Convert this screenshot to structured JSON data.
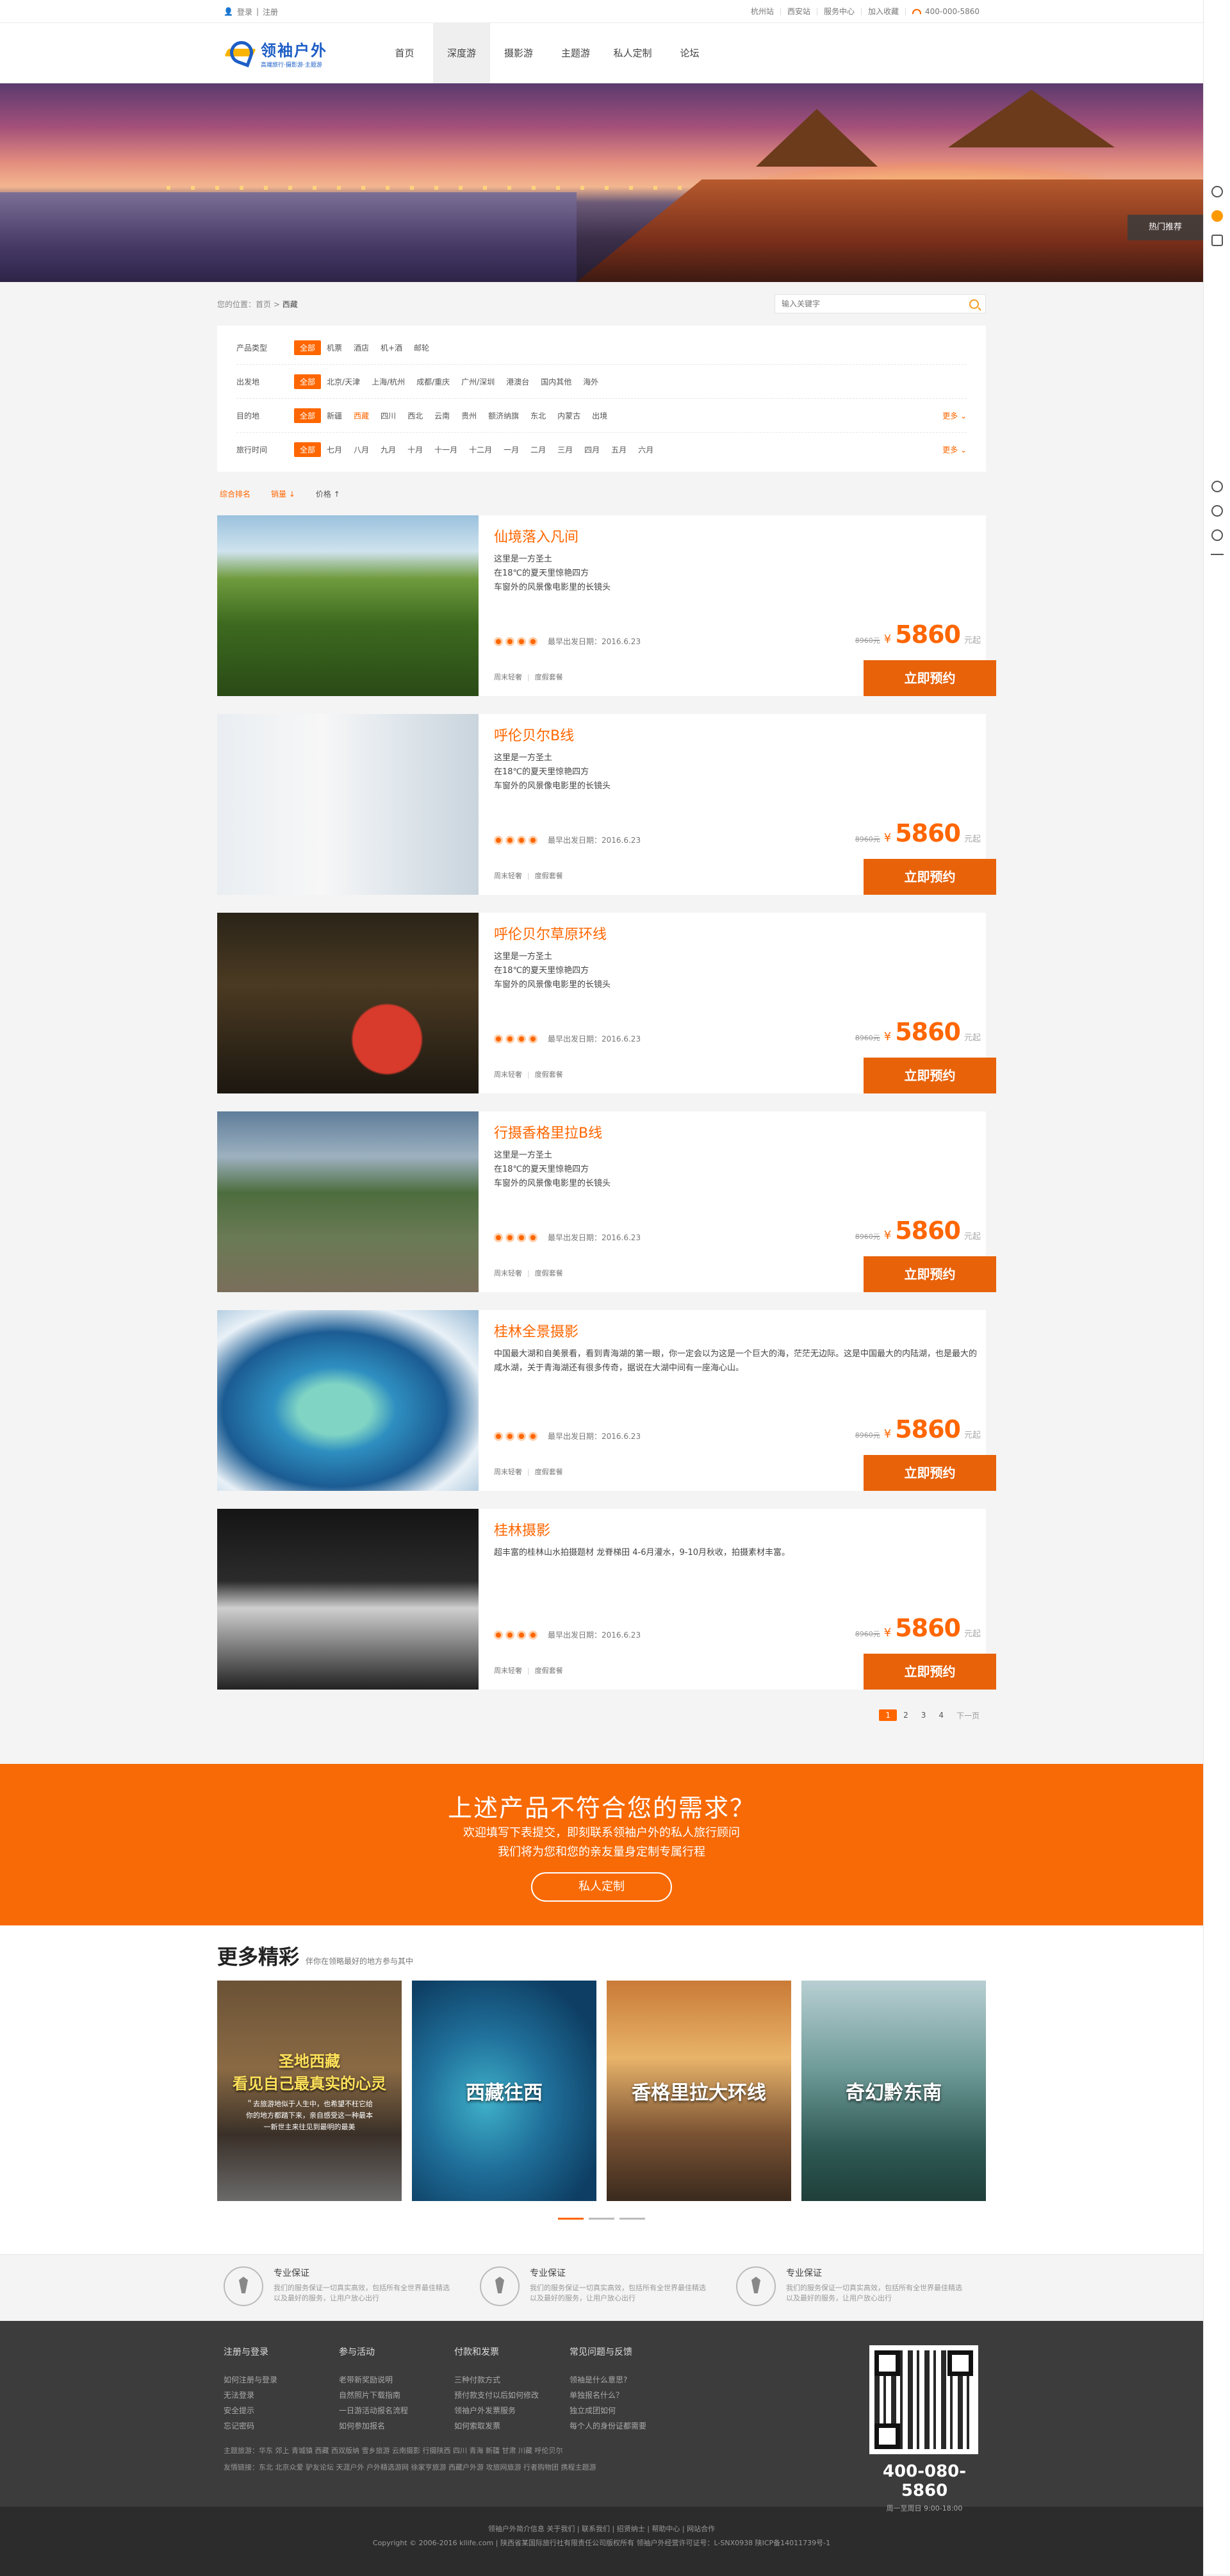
{
  "topbar": {
    "login": "登录",
    "register": "注册",
    "links": [
      "杭州站",
      "西安站",
      "服务中心",
      "加入收藏"
    ],
    "phone": "400-000-5860"
  },
  "header": {
    "logo_title": "领袖户外",
    "logo_sub": "高端旅行·摄影游·主题游",
    "nav": [
      "首页",
      "深度游",
      "摄影游",
      "主题游",
      "私人定制",
      "论坛"
    ],
    "active_index": 1
  },
  "banner": {
    "hot_label": "热门推荐"
  },
  "breadcrumb": {
    "prefix": "您的位置：首页 >",
    "current": "西藏"
  },
  "search": {
    "placeholder": "输入关键字"
  },
  "filters": [
    {
      "label": "产品类型",
      "options": [
        "全部",
        "机票",
        "酒店",
        "机+酒",
        "邮轮"
      ]
    },
    {
      "label": "出发地",
      "options": [
        "全部",
        "北京/天津",
        "上海/杭州",
        "成都/重庆",
        "广州/深圳",
        "港澳台",
        "国内其他",
        "海外"
      ]
    },
    {
      "label": "目的地",
      "options": [
        "全部",
        "新疆",
        "西藏",
        "四川",
        "西北",
        "云南",
        "贵州",
        "额济纳旗",
        "东北",
        "内蒙古",
        "出境"
      ],
      "more": "更多"
    },
    {
      "label": "旅行时间",
      "options": [
        "全部",
        "七月",
        "八月",
        "九月",
        "十月",
        "十一月",
        "十二月",
        "一月",
        "二月",
        "三月",
        "四月",
        "五月",
        "六月"
      ],
      "more": "更多"
    }
  ],
  "sort": [
    "综合排名",
    "销量 ↓",
    "价格 ↑"
  ],
  "products": [
    {
      "title": "仙境落入凡间",
      "desc": [
        "这里是一方圣土",
        "在18℃的夏天里惊艳四方",
        "车窗外的风景像电影里的长镜头"
      ],
      "date_label": "最早出发日期：2016.6.23",
      "old_price": "8960元",
      "yen": "¥",
      "price": "5860",
      "unit": "元起",
      "tags": [
        "周末轻奢",
        "度假套餐"
      ],
      "book": "立即预约"
    },
    {
      "title": "呼伦贝尔B线",
      "desc": [
        "这里是一方圣土",
        "在18℃的夏天里惊艳四方",
        "车窗外的风景像电影里的长镜头"
      ],
      "date_label": "最早出发日期：2016.6.23",
      "old_price": "8960元",
      "yen": "¥",
      "price": "5860",
      "unit": "元起",
      "tags": [
        "周末轻奢",
        "度假套餐"
      ],
      "book": "立即预约"
    },
    {
      "title": "呼伦贝尔草原环线",
      "desc": [
        "这里是一方圣土",
        "在18℃的夏天里惊艳四方",
        "车窗外的风景像电影里的长镜头"
      ],
      "date_label": "最早出发日期：2016.6.23",
      "old_price": "8960元",
      "yen": "¥",
      "price": "5860",
      "unit": "元起",
      "tags": [
        "周末轻奢",
        "度假套餐"
      ],
      "book": "立即预约"
    },
    {
      "title": "行摄香格里拉B线",
      "desc": [
        "这里是一方圣土",
        "在18℃的夏天里惊艳四方",
        "车窗外的风景像电影里的长镜头"
      ],
      "date_label": "最早出发日期：2016.6.23",
      "old_price": "8960元",
      "yen": "¥",
      "price": "5860",
      "unit": "元起",
      "tags": [
        "周末轻奢",
        "度假套餐"
      ],
      "book": "立即预约"
    },
    {
      "title": "桂林全景摄影",
      "desc": [
        "中国最大湖和自美景看，看到青海湖的第一眼，你一定会以为这是一个巨大的海，茫茫无边际。这是中国最大的内陆湖，也是最大的咸水湖，关于青海湖还有很多传奇，据说在大湖中间有一座海心山。"
      ],
      "date_label": "最早出发日期：2016.6.23",
      "old_price": "8960元",
      "yen": "¥",
      "price": "5860",
      "unit": "元起",
      "tags": [
        "周末轻奢",
        "度假套餐"
      ],
      "book": "立即预约"
    },
    {
      "title": "桂林摄影",
      "desc": [
        "超丰富的桂林山水拍摄题材 龙脊梯田 4-6月灌水，9-10月秋收，拍摄素材丰富。"
      ],
      "date_label": "最早出发日期：2016.6.23",
      "old_price": "8960元",
      "yen": "¥",
      "price": "5860",
      "unit": "元起",
      "tags": [
        "周末轻奢",
        "度假套餐"
      ],
      "book": "立即预约"
    }
  ],
  "pager": [
    "1",
    "2",
    "3",
    "4",
    "下一页"
  ],
  "cta": {
    "title": "上述产品不符合您的需求？",
    "line1": "欢迎填写下表提交，即刻联系领袖户外的私人旅行顾问",
    "line2": "我们将为您和您的亲友量身定制专属行程",
    "button": "私人定制"
  },
  "more": {
    "title": "更多精彩",
    "subtitle": "伴你在领略最好的地方参与其中",
    "tiles": [
      {
        "title": "圣地西藏",
        "sub": "看见自己最真实的心灵",
        "small": "＂去旅游地似于人生中，也希望不枉它给你的地方都踏下来，亲自感受这一种最本一新世主来往见到最明的最美"
      },
      {
        "title": "西藏往西",
        "sub": "",
        "small": ""
      },
      {
        "title": "香格里拉大环线",
        "sub": "",
        "small": ""
      },
      {
        "title": "奇幻黔东南",
        "sub": "",
        "small": ""
      }
    ]
  },
  "guarantees": [
    {
      "title": "专业保证",
      "desc": "我们的服务保证一切真实高效，包括所有全世界最佳精选以及最好的服务，让用户放心出行"
    },
    {
      "title": "专业保证",
      "desc": "我们的服务保证一切真实高效，包括所有全世界最佳精选以及最好的服务，让用户放心出行"
    },
    {
      "title": "专业保证",
      "desc": "我们的服务保证一切真实高效，包括所有全世界最佳精选以及最好的服务，让用户放心出行"
    }
  ],
  "footer": {
    "cols": [
      {
        "title": "注册与登录",
        "items": [
          "如何注册与登录",
          "无法登录",
          "安全提示",
          "忘记密码"
        ]
      },
      {
        "title": "参与活动",
        "items": [
          "老带新奖励说明",
          "自然照片下载指南",
          "一日游活动报名流程",
          "如何参加报名"
        ]
      },
      {
        "title": "付款和发票",
        "items": [
          "三种付款方式",
          "预付款支付以后如何修改",
          "领袖户外发票服务",
          "如何索取发票"
        ]
      },
      {
        "title": "常见问题与反馈",
        "items": [
          "领袖是什么意思?",
          "单独报名什么？",
          "独立成团如何",
          "每个人的身份证都需要"
        ]
      }
    ],
    "links1": "主题旅游：华东  郊上  青城镇  西藏  西双版纳  雪乡旅游  云南摄影  行摄陕西  四川  青海  新疆  甘肃  川藏  呼伦贝尔",
    "links2": "友情链接：东北  北京众爱  驴友论坛  天涯户外  户外精选游网  徐家亨旅游  西藏户外游  攻旅网旅游  行者购物团  携程主题游",
    "tel": "400-080-5860",
    "hours": "周一至周日 9:00-18:00",
    "copy1": "领袖户外简介信息   关于我们  |  联系我们  |  招贤纳士  |  帮助中心  |  网站合作",
    "copy2": "Copyright © 2006-2016 kllife.com  |  陕西省某国际旅行社有限责任公司版权所有    领袖户外经营许可证号：L-SNX0938 陕ICP备14011739号-1"
  }
}
